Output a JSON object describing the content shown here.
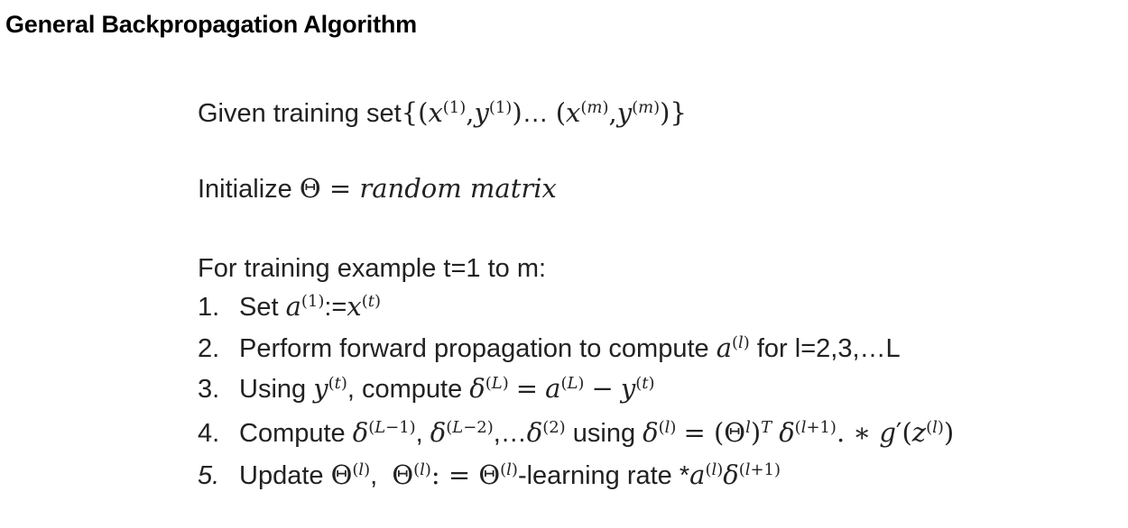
{
  "title": "General Backpropagation Algorithm",
  "given": {
    "label": "Given training set",
    "formula": "{(x(1), y(1))… (x(m), y(m))}"
  },
  "initialize": {
    "label": "Initialize",
    "formula": "Θ = random matrix"
  },
  "loop": {
    "header": "For training example t=1 to m:",
    "steps": [
      {
        "number": "1.",
        "text": "Set a(1):=x(t)"
      },
      {
        "number": "2.",
        "text": "Perform forward propagation to compute a(l) for l=2,3,…L"
      },
      {
        "number": "3.",
        "text": "Using y(t), compute δ(L) = a(L) − y(t)"
      },
      {
        "number": "4.",
        "text": "Compute δ(L−1), δ(L−2),…δ(2) using δ(l) = (Θl)T δ(l+1) .* g′(z(l))"
      },
      {
        "number": "5.",
        "text": "Update Θ(l), Θ(l): = Θ(l)-learning rate *a(l)δ(l+1)"
      }
    ]
  }
}
